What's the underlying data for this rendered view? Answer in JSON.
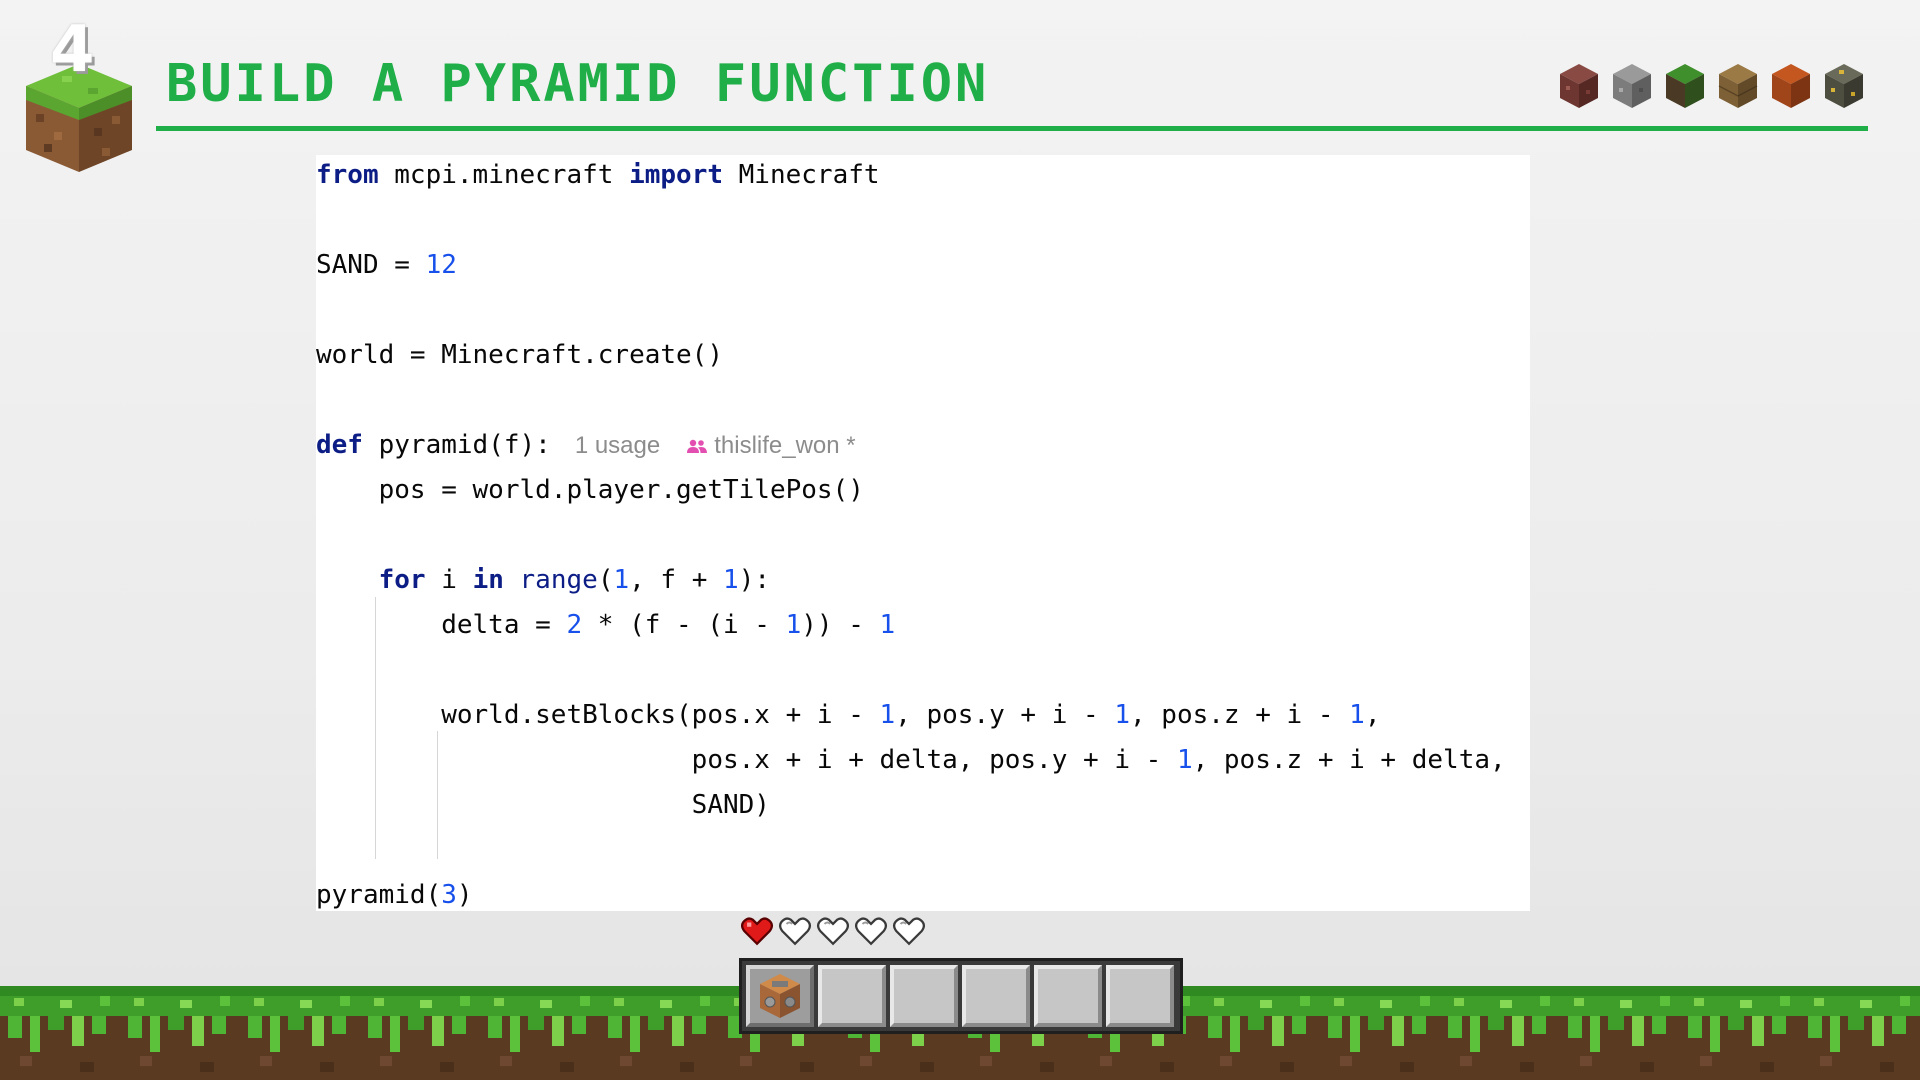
{
  "slide": {
    "number": "4",
    "title": "Build a Pyramid Function"
  },
  "header_blocks": [
    "netherrack-block-icon",
    "stone-block-icon",
    "grass-block-icon",
    "plank-block-icon",
    "terracotta-block-icon",
    "ore-block-icon"
  ],
  "code": {
    "line1": {
      "kw1": "from",
      "mod": " mcpi.minecraft ",
      "kw2": "import",
      "name": " Minecraft"
    },
    "line2": {
      "lhs": "SAND = ",
      "val": "12"
    },
    "line3": {
      "text": "world = Minecraft.create()"
    },
    "line4": {
      "kw": "def",
      "sig": " pyramid(f):",
      "usage_hint": "1 usage",
      "author_hint": "thislife_won *"
    },
    "line5": {
      "text": "    pos = world.player.getTilePos()"
    },
    "line6": {
      "indent": "    ",
      "kw1": "for",
      "a": " i ",
      "kw2": "in",
      "sp": " ",
      "fn": "range",
      "b": "(",
      "n1": "1",
      "c": ", f + ",
      "n2": "1",
      "d": "):"
    },
    "line7": {
      "a": "        delta = ",
      "n1": "2",
      "b": " * (f - (i - ",
      "n2": "1",
      "c": ")) - ",
      "n3": "1"
    },
    "line8": {
      "a": "        world.setBlocks(pos.x + i - ",
      "n1": "1",
      "b": ", pos.y + i - ",
      "n2": "1",
      "c": ", pos.z + i - ",
      "n3": "1",
      "d": ","
    },
    "line9": {
      "a": "                        pos.x + i + delta, pos.y + i - ",
      "n1": "1",
      "b": ", pos.z + i + delta,"
    },
    "line10": {
      "text": "                        SAND)"
    },
    "line11": {
      "a": "pyramid(",
      "n1": "3",
      "b": ")"
    }
  },
  "hud": {
    "hearts_total": 5,
    "hearts_full": 1,
    "hotbar_slots": 6,
    "selected_slot": 1,
    "slot_item": "command-block-icon"
  },
  "colors": {
    "accent_green": "#1fae48",
    "keyword": "#0c1d86",
    "number": "#1750eb",
    "heart": "#e01919"
  }
}
